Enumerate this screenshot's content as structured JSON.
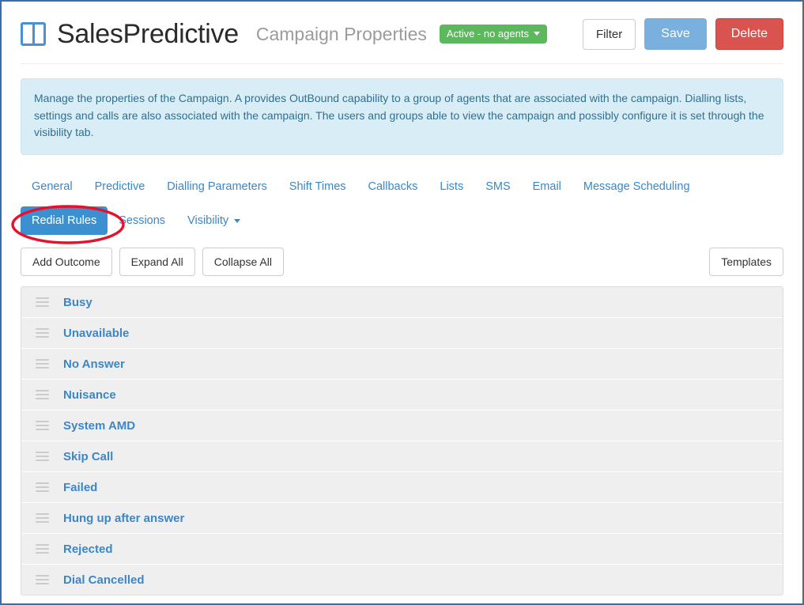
{
  "header": {
    "logo_icon": "columns-layout-icon",
    "brand": "SalesPredictive",
    "subtitle": "Campaign Properties",
    "status_badge": {
      "label": "Active - no agents",
      "color": "#5cb85c",
      "caret_icon": "caret-down-icon"
    },
    "actions": {
      "filter": "Filter",
      "save": "Save",
      "delete": "Delete"
    },
    "colors": {
      "save": "#79b0dd",
      "delete": "#d9534f"
    }
  },
  "info": {
    "text": "Manage the properties of the Campaign. A provides OutBound capability to a group of agents that are associated with the campaign. Dialling lists, settings and calls are also associated with the campaign. The users and groups able to view the campaign and possibly configure it is set through the visibility tab.",
    "background": "#d9edf7",
    "text_color": "#31708f"
  },
  "tabs": [
    {
      "label": "General",
      "active": false,
      "has_caret": false
    },
    {
      "label": "Predictive",
      "active": false,
      "has_caret": false
    },
    {
      "label": "Dialling Parameters",
      "active": false,
      "has_caret": false
    },
    {
      "label": "Shift Times",
      "active": false,
      "has_caret": false
    },
    {
      "label": "Callbacks",
      "active": false,
      "has_caret": false
    },
    {
      "label": "Lists",
      "active": false,
      "has_caret": false
    },
    {
      "label": "SMS",
      "active": false,
      "has_caret": false
    },
    {
      "label": "Email",
      "active": false,
      "has_caret": false
    },
    {
      "label": "Message Scheduling",
      "active": false,
      "has_caret": false
    },
    {
      "label": "Redial Rules",
      "active": true,
      "has_caret": false
    },
    {
      "label": "Sessions",
      "active": false,
      "has_caret": false
    },
    {
      "label": "Visibility",
      "active": false,
      "has_caret": true
    }
  ],
  "annotation": {
    "shape": "ellipse",
    "color": "#e8112d",
    "target_tab": "Redial Rules"
  },
  "toolbar": {
    "add_outcome": "Add Outcome",
    "expand_all": "Expand All",
    "collapse_all": "Collapse All",
    "templates": "Templates"
  },
  "outcomes": [
    {
      "label": "Busy",
      "handle_icon": "drag-handle-icon"
    },
    {
      "label": "Unavailable",
      "handle_icon": "drag-handle-icon"
    },
    {
      "label": "No Answer",
      "handle_icon": "drag-handle-icon"
    },
    {
      "label": "Nuisance",
      "handle_icon": "drag-handle-icon"
    },
    {
      "label": "System AMD",
      "handle_icon": "drag-handle-icon"
    },
    {
      "label": "Skip Call",
      "handle_icon": "drag-handle-icon"
    },
    {
      "label": "Failed",
      "handle_icon": "drag-handle-icon"
    },
    {
      "label": "Hung up after answer",
      "handle_icon": "drag-handle-icon"
    },
    {
      "label": "Rejected",
      "handle_icon": "drag-handle-icon"
    },
    {
      "label": "Dial Cancelled",
      "handle_icon": "drag-handle-icon"
    }
  ]
}
